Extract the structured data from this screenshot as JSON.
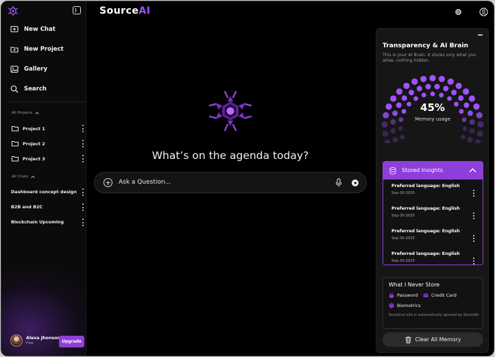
{
  "app": {
    "brand_main": "Source",
    "brand_accent": "AI"
  },
  "sidebar": {
    "nav": [
      {
        "label": "New Chat",
        "icon": "new-chat-icon"
      },
      {
        "label": "New Project",
        "icon": "folder-plus-icon"
      },
      {
        "label": "Gallery",
        "icon": "gallery-icon"
      },
      {
        "label": "Search",
        "icon": "search-icon"
      }
    ],
    "projects_label": "All Projects",
    "projects": [
      {
        "label": "Project 1"
      },
      {
        "label": "Project 2"
      },
      {
        "label": "Project 3"
      }
    ],
    "chats_label": "All Chats",
    "chats": [
      {
        "label": "Dashboard concept design"
      },
      {
        "label": "B2B and B2C"
      },
      {
        "label": "Blockchain Upcoming"
      }
    ],
    "user": {
      "name": "Alexa Jhonson",
      "plan": "Free"
    },
    "upgrade_label": "Upgrade"
  },
  "main": {
    "headline": "What’s on the agenda today?",
    "ask_placeholder": "Ask a Question..."
  },
  "panel": {
    "title": "Transparency & AI Brain",
    "subtitle": "This is your AI Brain. It stores only what you allow, nothing hidden.",
    "memory_percent": "45%",
    "memory_fraction": 0.45,
    "memory_label": "Memory usage",
    "insights_title": "Stored Insights",
    "insights": [
      {
        "text": "Preferred language: English",
        "date": "Sep-30-2025"
      },
      {
        "text": "Preferred language: English",
        "date": "Sep-30-2025"
      },
      {
        "text": "Preferred language: English",
        "date": "Sep-30-2025"
      },
      {
        "text": "Preferred language: English",
        "date": "Sep-30-2025"
      }
    ],
    "never_title": "What I Never Store",
    "never_items": [
      {
        "label": "Password",
        "icon": "lock-icon"
      },
      {
        "label": "Credit Card",
        "icon": "credit-card-icon"
      },
      {
        "label": "Biometrics",
        "icon": "fingerprint-icon"
      }
    ],
    "never_note": "Sensitive info is automatically ignored by StoredAI",
    "clear_label": "Clear All Memory"
  },
  "colors": {
    "accent": "#8e3fd9",
    "accent_light": "#a052ff",
    "background": "#000000",
    "panel": "#161616",
    "dot_inactive": "#3a1f5c"
  }
}
